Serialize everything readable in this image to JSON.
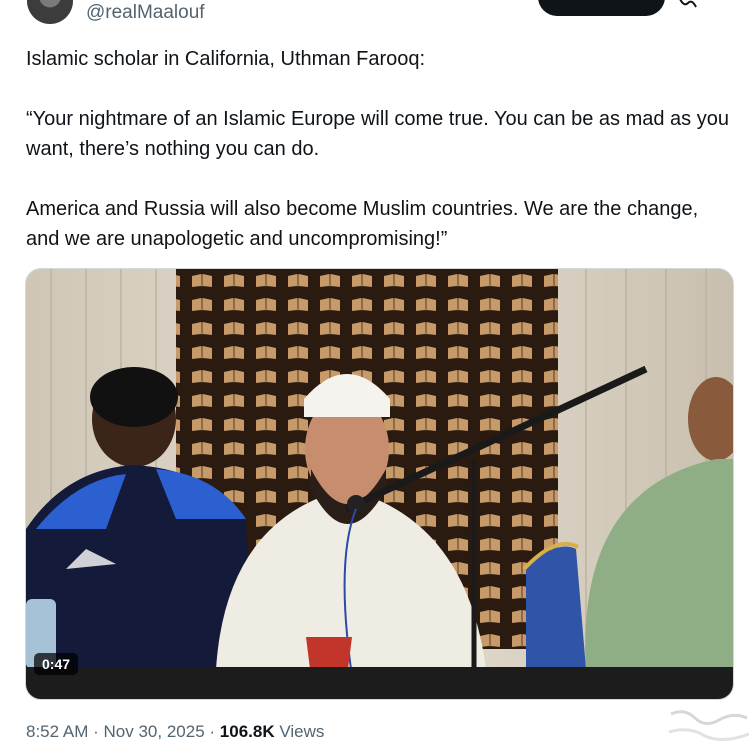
{
  "author": {
    "handle": "@realMaalouf"
  },
  "tweet": {
    "paragraphs": [
      "Islamic scholar in California, Uthman Farooq:",
      "“Your nightmare of an Islamic Europe will come true. You can be as mad as you want, there’s nothing you can do.",
      "America and Russia will also become Muslim countries. We are the change, and we are unapologetic and uncompromising!”"
    ]
  },
  "media": {
    "duration": "0:47"
  },
  "meta": {
    "time": "8:52 AM",
    "separator": "·",
    "date": "Nov 30, 2025",
    "views_count": "106.8K",
    "views_label": "Views"
  },
  "icons": {
    "grok": "grok-icon",
    "avatar": "avatar",
    "watermark": "watermark-icon"
  }
}
